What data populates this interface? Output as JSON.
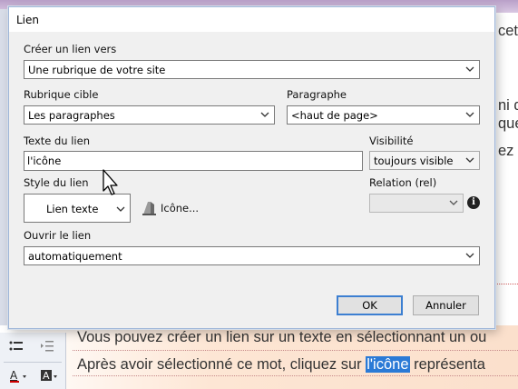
{
  "background": {
    "frag_line1": "cet",
    "frag_line2a": "ni q",
    "frag_line2b": "que",
    "frag_line3": "ez c",
    "para1": "Vous pouvez créer un lien sur un texte en sélectionnant un ou",
    "para2_before": "Après avoir sélectionné ce mot, cliquez sur ",
    "para2_selected": "l'icône",
    "para2_after": " représenta"
  },
  "dialog": {
    "title": "Lien",
    "create_link_label": "Créer un lien vers",
    "create_link_value": "Une rubrique de votre site",
    "target_section_label": "Rubrique cible",
    "target_section_value": "Les paragraphes",
    "paragraph_label": "Paragraphe",
    "paragraph_value": "<haut de page>",
    "link_text_label": "Texte du lien",
    "link_text_value": "l'icône",
    "visibility_label": "Visibilité",
    "visibility_value": "toujours visible",
    "link_style_label": "Style du lien",
    "link_style_value": "Lien texte",
    "icon_button_label": "Icône...",
    "relation_label": "Relation (rel)",
    "relation_value": "",
    "open_link_label": "Ouvrir le lien",
    "open_link_value": "automatiquement",
    "ok_label": "OK",
    "cancel_label": "Annuler"
  }
}
